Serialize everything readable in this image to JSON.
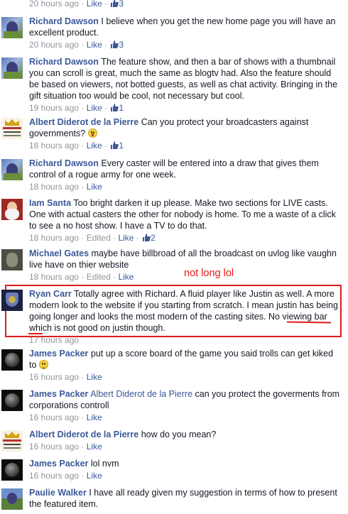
{
  "common": {
    "like": "Like",
    "edited": "Edited",
    "sep": " · "
  },
  "comments": [
    {
      "time": "20 hours ago",
      "likes": "3"
    },
    {
      "author": "Richard Dawson",
      "text": "I believe when you get the new home page you will have an excellent product.",
      "time": "20 hours ago",
      "likes": "3"
    },
    {
      "author": "Richard Dawson",
      "text": "The feature show, and then a bar of shows with a thumbnail you can scroll is great, much the same as blogtv had. Also the feature should be based on viewers, not botted guests, as well as chat activity. Bringing in the gift situation too would be cool, not necessary but cool.",
      "time": "19 hours ago",
      "likes": "1"
    },
    {
      "author": "Albert Diderot de la Pierre",
      "text": "Can you protect your broadcasters against governments?",
      "time": "18 hours ago",
      "likes": "1"
    },
    {
      "author": "Richard Dawson",
      "text": "Every caster will be entered into a draw that gives them control of a rogue army for one week.",
      "time": "18 hours ago"
    },
    {
      "author": "Iam Santa",
      "text": "Too bright darken it up please. Make two sections for LIVE casts. One with actual casters the other for nobody is home. To me a waste of a click to see a no host show. I have a TV to do that.",
      "time": "18 hours ago",
      "likes": "2"
    },
    {
      "author": "Michael Gates",
      "text": "maybe have billbroad of all the broadcast on uvlog like vaughn live have on thier website",
      "time": "18 hours ago"
    },
    {
      "author": "Ryan Carr",
      "text": "Totally agree with Richard. A fluid player like Justin as well. A more modern look to the website if you starting from scratch. I mean justin has being going longer and looks the most modern of the casting sites. No viewing bar which is not good on justin though.",
      "time": "17 hours ago"
    },
    {
      "author": "James Packer",
      "text": "put up a score board of the game you said trolls can get kiked to",
      "time": "16 hours ago"
    },
    {
      "author": "James Packer",
      "mention": "Albert Diderot de la Pierre",
      "text": "can you protect the goverments from corporations controll",
      "time": "16 hours ago"
    },
    {
      "author": "Albert Diderot de la Pierre",
      "text": "how do you mean?",
      "time": "16 hours ago"
    },
    {
      "author": "James Packer",
      "text": "lol nvm",
      "time": "16 hours ago"
    },
    {
      "author": "Paulie Walker",
      "text": "I have all ready given my suggestion in terms of how to present the featured item."
    }
  ],
  "annotation": {
    "text": "not long lol",
    "color": "#e21b1b"
  },
  "colors": {
    "link": "#3b5998",
    "meta": "#90949c",
    "annotation": "#e21b1b"
  },
  "icons": [
    "thumbs-up-icon",
    "emoji-wow-icon",
    "emoji-smile-icon"
  ]
}
